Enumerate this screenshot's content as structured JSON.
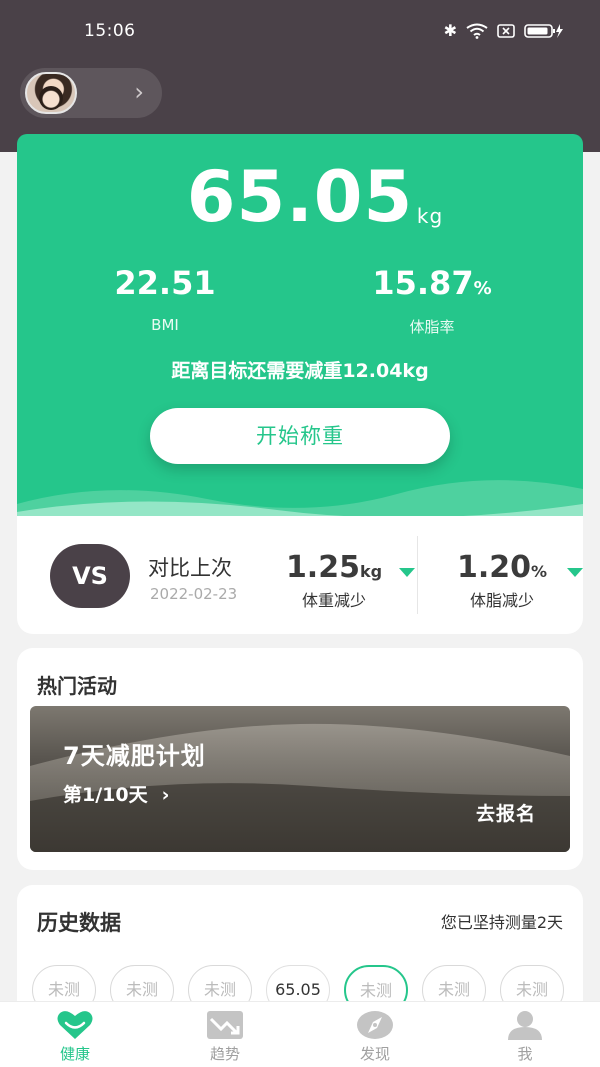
{
  "status_bar": {
    "time": "15:06"
  },
  "profile": {
    "chevron": "›"
  },
  "hero": {
    "weight": "65.05",
    "weight_unit": "kg",
    "bmi_value": "22.51",
    "bmi_label": "BMI",
    "fat_value": "15.87",
    "fat_unit": "%",
    "fat_label": "体脂率",
    "goal_text": "距离目标还需要减重12.04kg",
    "weigh_button": "开始称重",
    "accent_color": "#25c68b"
  },
  "compare": {
    "badge": "VS",
    "title": "对比上次",
    "date": "2022-02-23",
    "weight_value": "1.25",
    "weight_unit": "kg",
    "weight_label": "体重减少",
    "fat_value": "1.20",
    "fat_unit": "%",
    "fat_label": "体脂减少"
  },
  "activities": {
    "title": "热门活动",
    "banner_title": "7天减肥计划",
    "banner_progress": "第1/10天",
    "banner_chevron": "›",
    "banner_cta": "去报名"
  },
  "history": {
    "title": "历史数据",
    "note": "您已坚持测量2天",
    "days": [
      "未测",
      "未测",
      "未测",
      "65.05",
      "未测",
      "未测",
      "未测"
    ]
  },
  "tabbar": {
    "items": [
      {
        "label": "健康",
        "icon": "heart-icon"
      },
      {
        "label": "趋势",
        "icon": "trend-icon"
      },
      {
        "label": "发现",
        "icon": "compass-icon"
      },
      {
        "label": "我",
        "icon": "user-icon"
      }
    ]
  }
}
